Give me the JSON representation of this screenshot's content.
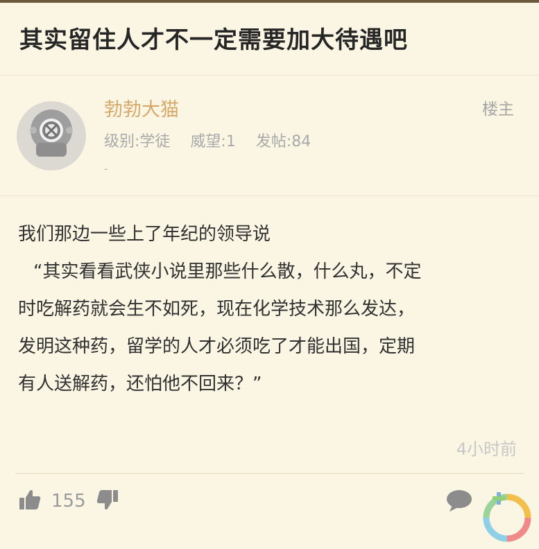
{
  "post": {
    "title": "其实留住人才不一定需要加大待遇吧"
  },
  "author": {
    "name": "勃勃大猫",
    "badge": "楼主",
    "level": "级别:学徒",
    "reputation": "威望:1",
    "posts": "发帖:84",
    "extra": "-"
  },
  "content": {
    "lines": [
      "我们那边一些上了年纪的领导说",
      "“其实看看武侠小说里那些什么散，什么丸，不定",
      "时吃解药就会生不如死，现在化学技术那么发达，",
      "发明这种药，留学的人才必须吃了才能出国，定期",
      "有人送解药，还怕他不回来？”"
    ]
  },
  "time": "4小时前",
  "actions": {
    "like_count": "155",
    "icons": [
      "thumbs-up-icon",
      "thumbs-down-icon",
      "comment-icon",
      "progress-ring-icon"
    ]
  },
  "colors": {
    "background": "#fbf6e4",
    "username": "#d6a86a",
    "muted": "#a9a9a9"
  }
}
